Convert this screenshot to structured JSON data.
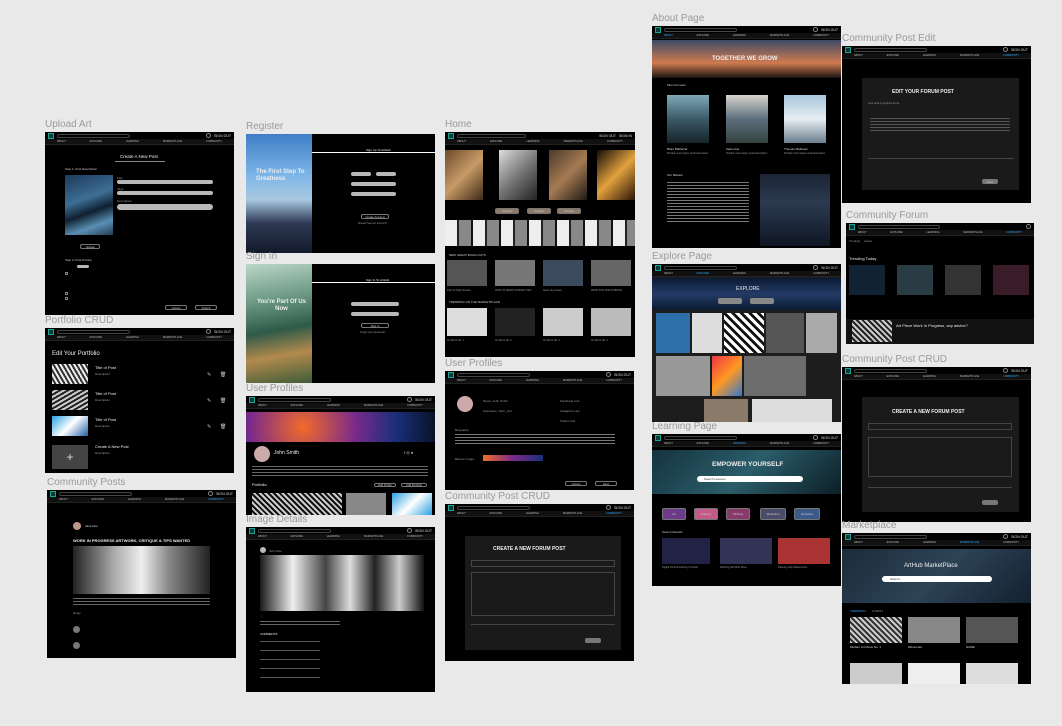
{
  "frames": {
    "upload": {
      "label": "Upload Art",
      "heading": "Create A New Post",
      "step1": "Step 1: Post Description",
      "step2": "Step 2: Post Privacy",
      "upload_btn": "Upload",
      "cancel": "Cancel",
      "submit": "Submit",
      "fields": [
        "Title",
        "Tags",
        "Description"
      ]
    },
    "register": {
      "label": "Register",
      "hero": "The First Step To Greatness",
      "heading": "Sign Up To ArtHub",
      "submit": "Create Account",
      "signin_link": "Already have an account?"
    },
    "signin": {
      "label": "Sign In",
      "hero": "You're Part Of Us Now",
      "heading": "Sign In To ArtHub",
      "submit": "Sign In",
      "forgot": "Forgot your password?"
    },
    "home": {
      "label": "Home",
      "btn_signout": "SIGN OUT",
      "btn_signin": "SIGN IN",
      "filters": [
        "Abstract",
        "Portrait",
        "Surreal"
      ],
      "section1": "NEW GREAT BUILD-OUTS",
      "section2": "TRENDING ON THE MARKETPLACE",
      "cards1": [
        "Post for Daily Studies",
        "HOW TO DRAW CONCEPT ART",
        "Neon city streets",
        "FROM THE SKETCHBOOK"
      ],
      "cards2": [
        "Art Piece No. 1",
        "Art Piece No. 2",
        "Art Piece No. 3",
        "Art Piece No. 4"
      ]
    },
    "about": {
      "label": "About Page",
      "hero": "TOGETHER WE GROW",
      "team": "Meet the team",
      "members": [
        {
          "name": "Brian Balthazar",
          "role": "Position and maybe small description"
        },
        {
          "name": "Zaria Hue",
          "role": "Position and maybe small description"
        },
        {
          "name": "Thomas Mathews",
          "role": "Position and maybe small description"
        }
      ],
      "mission": "Our Mission"
    },
    "cpe": {
      "label": "Community Post Edit",
      "heading": "EDIT YOUR FORUM POST",
      "subtitle": "Cool work in progress #1 art",
      "save": "Save"
    },
    "forum": {
      "label": "Community Forum",
      "tabs": [
        "Trending",
        "Latest"
      ],
      "trending": "Trending Today",
      "post": "Art Piece Work In Progress, any advice?"
    },
    "explore": {
      "label": "Explore Page",
      "heading": "EXPLORE"
    },
    "portfolio": {
      "label": "Portfolio CRUD",
      "heading": "Edit Your Portfolio",
      "items": [
        {
          "title": "Title of Post",
          "desc": "Description"
        },
        {
          "title": "Title of Post",
          "desc": "Description"
        },
        {
          "title": "Title of Post",
          "desc": "Description"
        }
      ],
      "create": "Create A New Post",
      "create_desc": "Description"
    },
    "profiles1": {
      "label": "User Profiles",
      "name": "John Smith",
      "portfolio": "Portfolio",
      "btn1": "Edit Profile",
      "btn2": "Add Portfolio"
    },
    "profiles2": {
      "label": "User Profiles",
      "name": "Name: John Smith",
      "username": "Username: John_123",
      "links": [
        "Facebook Link",
        "Instagram Link",
        "Twitter Link"
      ],
      "bio": "Biography:",
      "banner": "Banner Image:",
      "cancel": "Cancel",
      "save": "Save"
    },
    "learning": {
      "label": "Learning Page",
      "hero": "EMPOWER YOURSELF",
      "search": "Search Lessons",
      "cats": [
        "Art",
        "Drawing",
        "Painting",
        "Illustration",
        "Animation"
      ],
      "results": "Search Results",
      "cards": [
        "Digital Portrait Painting Tutorial",
        "Painting with Bob Ross",
        "Painting with Watercolors"
      ]
    },
    "cpcrud1": {
      "label": "Community Post CRUD",
      "heading": "CREATE A NEW FORUM POST"
    },
    "cpcrud2": {
      "label": "Community Post CRUD",
      "heading": "CREATE A NEW FORUM POST"
    },
    "posts": {
      "label": "Community Posts",
      "author": "Jane Doe",
      "title": "WORK IN PROGRESS ARTWORK, CRITIQUE & TIPS WANTED",
      "reply": "Reply"
    },
    "details": {
      "label": "Image Details",
      "author": "John Doe",
      "comments": "COMMENTS"
    },
    "market": {
      "label": "Marketplace",
      "hero": "ArtHub MarketPlace",
      "search": "Search...",
      "tabs": [
        "TRENDING",
        "LATEST"
      ],
      "items": [
        "Modern Art Piece No. 1",
        "Mona Lisa",
        "NAME"
      ]
    }
  },
  "nav": [
    "About",
    "Explore",
    "Learning",
    "Marketplace",
    "Community"
  ],
  "signout": "SIGN OUT",
  "colors": {
    "accent": "#2ea8ff",
    "brand": "#1aa49a",
    "panel": "#000000",
    "canvas": "#e9e9e9"
  }
}
